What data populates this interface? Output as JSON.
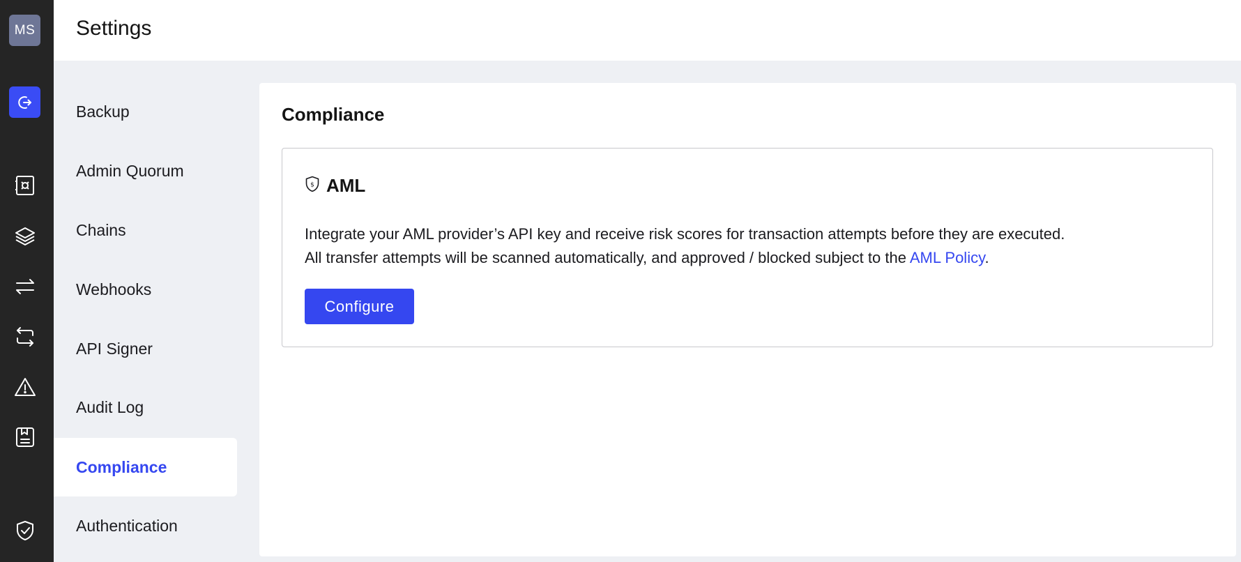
{
  "rail": {
    "avatar_initials": "MS",
    "icons": [
      "logout-icon",
      "vault-icon",
      "layers-icon",
      "transfer-icon",
      "swap-icon",
      "alert-icon",
      "policy-icon",
      "shield-check-icon"
    ]
  },
  "header": {
    "title": "Settings"
  },
  "settings_nav": {
    "items": [
      {
        "label": "Backup"
      },
      {
        "label": "Admin Quorum"
      },
      {
        "label": "Chains"
      },
      {
        "label": "Webhooks"
      },
      {
        "label": "API Signer"
      },
      {
        "label": "Audit Log"
      },
      {
        "label": "Compliance",
        "active": true
      },
      {
        "label": "Authentication"
      }
    ]
  },
  "main": {
    "section_title": "Compliance",
    "aml": {
      "icon": "shield-dollar-icon",
      "title": "AML",
      "line1": "Integrate your AML provider’s API key and receive risk scores for transaction attempts before they are executed.",
      "line2_prefix": "All transfer attempts will be scanned automatically, and approved / blocked subject to the ",
      "policy_link": "AML Policy",
      "line2_suffix": ".",
      "button_label": "Configure"
    }
  },
  "colors": {
    "accent": "#3547f0",
    "rail_bg": "#252525",
    "page_bg": "#eef0f4",
    "avatar_bg": "#6e7696"
  }
}
